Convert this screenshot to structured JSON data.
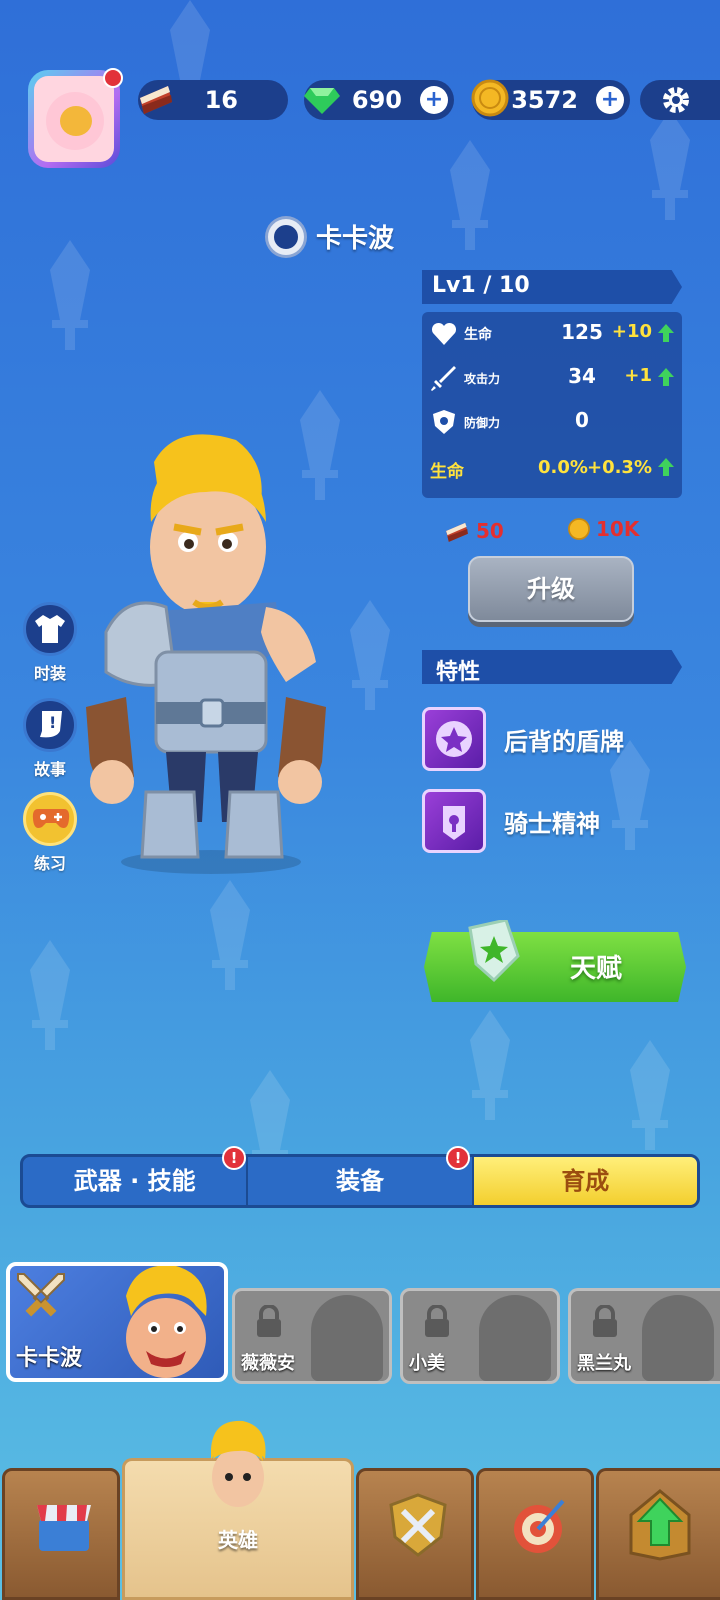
{
  "top_bar": {
    "cake_count": "16",
    "gem_count": "690",
    "coin_count": "3572",
    "icons": [
      "avatar",
      "cake-icon",
      "gem-icon",
      "coin-icon",
      "plus-icon",
      "gear-icon"
    ]
  },
  "hero": {
    "name": "卡卡波",
    "level": "Lv1 / 10",
    "stats": [
      {
        "label": "生命",
        "value": "125",
        "increase": "+10",
        "icon": "heart-icon"
      },
      {
        "label": "攻击力",
        "value": "34",
        "increase": "+1",
        "icon": "sword-icon"
      },
      {
        "label": "防御力",
        "value": "0",
        "increase": "",
        "icon": "shield-icon"
      }
    ],
    "bonus": {
      "label": "生命",
      "value": "0.0%",
      "increase": "+0.3%"
    },
    "upgrade_cost": {
      "cake": "50",
      "coin": "10K"
    },
    "upgrade_label": "升级",
    "traits_title": "特性",
    "traits": [
      {
        "name": "后背的盾牌",
        "icon": "shield-trait-icon"
      },
      {
        "name": "骑士精神",
        "icon": "knight-trait-icon"
      }
    ],
    "talent_label": "天赋"
  },
  "side_buttons": [
    {
      "label": "时装",
      "icon": "shirt-icon"
    },
    {
      "label": "故事",
      "icon": "story-icon"
    },
    {
      "label": "练习",
      "icon": "gamepad-icon"
    }
  ],
  "tabs": [
    {
      "label": "武器 · 技能",
      "alert": "!"
    },
    {
      "label": "装备",
      "alert": "!"
    },
    {
      "label": "育成",
      "active": true
    }
  ],
  "hero_cards": [
    {
      "name": "卡卡波",
      "selected": true
    },
    {
      "name": "薇薇安",
      "locked": true
    },
    {
      "name": "小美",
      "locked": true
    },
    {
      "name": "黑兰丸",
      "locked": true
    }
  ],
  "bottom_nav": [
    {
      "label": "",
      "icon": "shop-icon"
    },
    {
      "label": "英雄",
      "icon": "hero-icon",
      "active": true
    },
    {
      "label": "",
      "icon": "battle-icon"
    },
    {
      "label": "",
      "icon": "target-icon"
    },
    {
      "label": "",
      "icon": "upgrade-arrow-icon"
    }
  ],
  "colors": {
    "accent_yellow": "#ffe23d",
    "tab_active": "#f3cf2e",
    "talent_green": "#3fb62a",
    "alert_red": "#e2323a"
  }
}
